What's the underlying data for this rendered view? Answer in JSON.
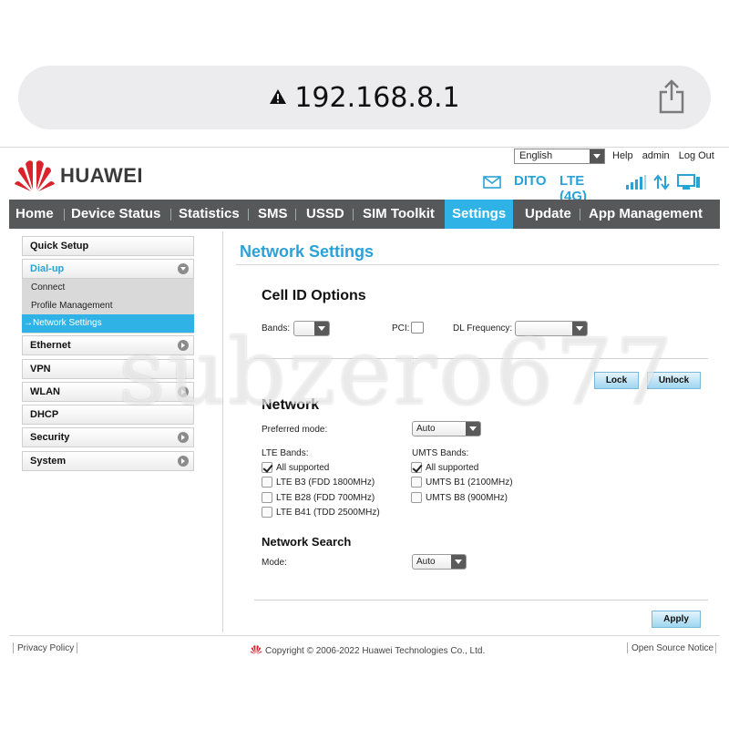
{
  "browser": {
    "url": "192.168.8.1",
    "icons": {
      "warning": "warning-triangle-icon",
      "share": "share-icon"
    }
  },
  "header": {
    "brand": "HUAWEI",
    "language": "English",
    "help": "Help",
    "user": "admin",
    "logout": "Log Out",
    "carrier": "DITO",
    "network_type": "LTE (4G)",
    "accent": "#2aa2d6"
  },
  "nav": {
    "items": [
      "Home",
      "Device Status",
      "Statistics",
      "SMS",
      "USSD",
      "SIM Toolkit",
      "Settings",
      "Update",
      "App Management"
    ],
    "active": "Settings",
    "bg": "#56585a",
    "active_bg": "#2fb3e6"
  },
  "sidebar": {
    "quick_setup": "Quick Setup",
    "dialup": "Dial-up",
    "dialup_items": [
      "Connect",
      "Profile Management",
      "→Network Settings"
    ],
    "ethernet": "Ethernet",
    "vpn": "VPN",
    "wlan": "WLAN",
    "dhcp": "DHCP",
    "security": "Security",
    "system": "System"
  },
  "main": {
    "title": "Network Settings",
    "cell_id": {
      "heading": "Cell ID Options",
      "bands_label": "Bands:",
      "pci_label": "PCI:",
      "dl_label": "DL Frequency:",
      "lock": "Lock",
      "unlock": "Unlock"
    },
    "network": {
      "heading": "Network",
      "preferred_label": "Preferred mode:",
      "preferred_value": "Auto",
      "lte_label": "LTE Bands:",
      "umts_label": "UMTS Bands:",
      "lte_bands": [
        {
          "label": "All supported",
          "checked": true
        },
        {
          "label": "LTE B3 (FDD 1800MHz)",
          "checked": false
        },
        {
          "label": "LTE B28 (FDD 700MHz)",
          "checked": false
        },
        {
          "label": "LTE B41 (TDD 2500MHz)",
          "checked": false
        }
      ],
      "umts_bands": [
        {
          "label": "All supported",
          "checked": true
        },
        {
          "label": "UMTS B1 (2100MHz)",
          "checked": false
        },
        {
          "label": "UMTS B8 (900MHz)",
          "checked": false
        }
      ]
    },
    "search": {
      "heading": "Network Search",
      "mode_label": "Mode:",
      "mode_value": "Auto"
    },
    "apply": "Apply"
  },
  "footer": {
    "privacy": "Privacy Policy",
    "copyright": "Copyright © 2006-2022 Huawei Technologies Co., Ltd.",
    "open_source": "Open Source Notice"
  },
  "watermark": "subzero677"
}
